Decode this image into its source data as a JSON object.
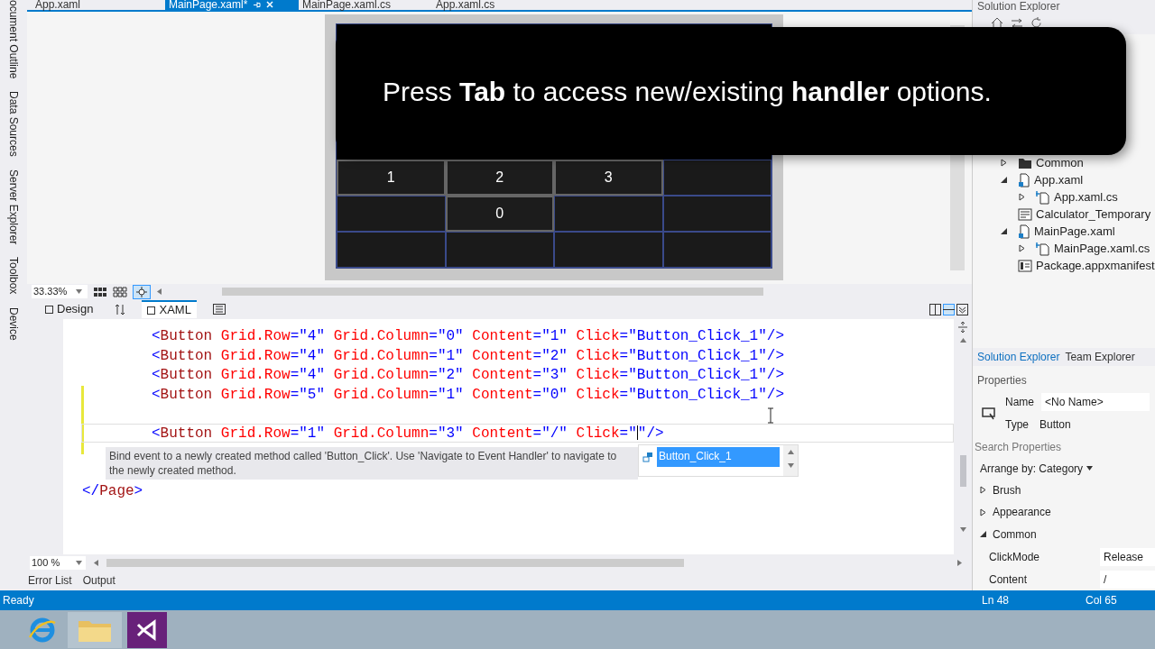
{
  "side_tabs": [
    "ocument Outline",
    "Data Sources",
    "Server Explorer",
    "Toolbox",
    "Device"
  ],
  "doc_tabs": [
    {
      "label": "App.xaml",
      "selected": false
    },
    {
      "label": "MainPage.xaml*",
      "selected": true
    },
    {
      "label": "MainPage.xaml.cs",
      "selected": false
    },
    {
      "label": "App.xaml.cs",
      "selected": false
    }
  ],
  "preview": {
    "rows": [
      [
        {
          "kind": "button",
          "label": "1"
        },
        {
          "kind": "button",
          "label": "2"
        },
        {
          "kind": "button",
          "label": "3"
        },
        {
          "kind": "empty"
        }
      ],
      [
        {
          "kind": "empty"
        },
        {
          "kind": "button",
          "label": "0"
        },
        {
          "kind": "empty"
        },
        {
          "kind": "empty"
        }
      ],
      [
        {
          "kind": "empty"
        },
        {
          "kind": "empty"
        },
        {
          "kind": "empty"
        },
        {
          "kind": "empty"
        }
      ]
    ]
  },
  "designer_zoom": "33.33%",
  "view_tabs": [
    {
      "label": "Design",
      "selected": false
    },
    {
      "label": "XAML",
      "selected": true
    }
  ],
  "code_lines": [
    {
      "kind": "nested",
      "current": false,
      "tokens": [
        {
          "kind": "bracket",
          "text": "<"
        },
        {
          "kind": "element",
          "text": "Button"
        },
        {
          "kind": "attr",
          "text": " Grid.Row"
        },
        {
          "kind": "bracket",
          "text": "="
        },
        {
          "kind": "value",
          "text": "\"4\""
        },
        {
          "kind": "attr",
          "text": " Grid.Column"
        },
        {
          "kind": "bracket",
          "text": "="
        },
        {
          "kind": "value",
          "text": "\"0\""
        },
        {
          "kind": "attr",
          "text": " Content"
        },
        {
          "kind": "bracket",
          "text": "="
        },
        {
          "kind": "value",
          "text": "\"1\""
        },
        {
          "kind": "attr",
          "text": " Click"
        },
        {
          "kind": "bracket",
          "text": "="
        },
        {
          "kind": "value",
          "text": "\"Button_Click_1\""
        },
        {
          "kind": "bracket",
          "text": "/>"
        }
      ]
    },
    {
      "kind": "nested",
      "current": false,
      "tokens": [
        {
          "kind": "bracket",
          "text": "<"
        },
        {
          "kind": "element",
          "text": "Button"
        },
        {
          "kind": "attr",
          "text": " Grid.Row"
        },
        {
          "kind": "bracket",
          "text": "="
        },
        {
          "kind": "value",
          "text": "\"4\""
        },
        {
          "kind": "attr",
          "text": " Grid.Column"
        },
        {
          "kind": "bracket",
          "text": "="
        },
        {
          "kind": "value",
          "text": "\"1\""
        },
        {
          "kind": "attr",
          "text": " Content"
        },
        {
          "kind": "bracket",
          "text": "="
        },
        {
          "kind": "value",
          "text": "\"2\""
        },
        {
          "kind": "attr",
          "text": " Click"
        },
        {
          "kind": "bracket",
          "text": "="
        },
        {
          "kind": "value",
          "text": "\"Button_Click_1\""
        },
        {
          "kind": "bracket",
          "text": "/>"
        }
      ]
    },
    {
      "kind": "nested",
      "current": false,
      "tokens": [
        {
          "kind": "bracket",
          "text": "<"
        },
        {
          "kind": "element",
          "text": "Button"
        },
        {
          "kind": "attr",
          "text": " Grid.Row"
        },
        {
          "kind": "bracket",
          "text": "="
        },
        {
          "kind": "value",
          "text": "\"4\""
        },
        {
          "kind": "attr",
          "text": " Grid.Column"
        },
        {
          "kind": "bracket",
          "text": "="
        },
        {
          "kind": "value",
          "text": "\"2\""
        },
        {
          "kind": "attr",
          "text": " Content"
        },
        {
          "kind": "bracket",
          "text": "="
        },
        {
          "kind": "value",
          "text": "\"3\""
        },
        {
          "kind": "attr",
          "text": " Click"
        },
        {
          "kind": "bracket",
          "text": "="
        },
        {
          "kind": "value",
          "text": "\"Button_Click_1\""
        },
        {
          "kind": "bracket",
          "text": "/>"
        }
      ]
    },
    {
      "kind": "nested",
      "current": false,
      "tokens": [
        {
          "kind": "bracket",
          "text": "<"
        },
        {
          "kind": "element",
          "text": "Button"
        },
        {
          "kind": "attr",
          "text": " Grid.Row"
        },
        {
          "kind": "bracket",
          "text": "="
        },
        {
          "kind": "value",
          "text": "\"5\""
        },
        {
          "kind": "attr",
          "text": " Grid.Column"
        },
        {
          "kind": "bracket",
          "text": "="
        },
        {
          "kind": "value",
          "text": "\"1\""
        },
        {
          "kind": "attr",
          "text": " Content"
        },
        {
          "kind": "bracket",
          "text": "="
        },
        {
          "kind": "value",
          "text": "\"0\""
        },
        {
          "kind": "attr",
          "text": " Click"
        },
        {
          "kind": "bracket",
          "text": "="
        },
        {
          "kind": "value",
          "text": "\"Button_Click_1\""
        },
        {
          "kind": "bracket",
          "text": "/>"
        }
      ]
    },
    {
      "kind": "blank"
    },
    {
      "kind": "nested",
      "current": true,
      "tokens": [
        {
          "kind": "bracket",
          "text": "<"
        },
        {
          "kind": "element",
          "text": "Button"
        },
        {
          "kind": "attr",
          "text": " Grid.Row"
        },
        {
          "kind": "bracket",
          "text": "="
        },
        {
          "kind": "value",
          "text": "\"1\""
        },
        {
          "kind": "attr",
          "text": " Grid.Column"
        },
        {
          "kind": "bracket",
          "text": "="
        },
        {
          "kind": "value",
          "text": "\"3\""
        },
        {
          "kind": "attr",
          "text": " Content"
        },
        {
          "kind": "bracket",
          "text": "="
        },
        {
          "kind": "value",
          "text": "\"/\""
        },
        {
          "kind": "attr",
          "text": " Click"
        },
        {
          "kind": "bracket",
          "text": "="
        },
        {
          "kind": "value",
          "text": "\""
        },
        {
          "kind": "caret"
        },
        {
          "kind": "value",
          "text": "\""
        },
        {
          "kind": "bracket",
          "text": "/>"
        }
      ]
    },
    {
      "kind": "blank"
    },
    {
      "kind": "blank"
    },
    {
      "kind": "top",
      "current": false,
      "tokens": [
        {
          "kind": "bracket",
          "text": "</"
        },
        {
          "kind": "element",
          "text": "Page"
        },
        {
          "kind": "bracket",
          "text": ">"
        }
      ]
    }
  ],
  "tooltip": "Bind event to a newly created method called 'Button_Click'. Use 'Navigate to Event Handler' to navigate to the newly created method.",
  "completion": [
    {
      "label": "Button_Click_1",
      "selected": true
    }
  ],
  "editor_zoom": "100 %",
  "bottom_tabs": [
    "Error List",
    "Output"
  ],
  "caption": "Press **Tab** to access new/existing **handler** options.",
  "solution_explorer": {
    "title": "Solution Explorer",
    "tree": [
      {
        "label": "Common",
        "kind": "folder",
        "expanded": false
      },
      {
        "label": "App.xaml",
        "kind": "xaml",
        "expanded": true,
        "children": [
          {
            "label": "App.xaml.cs",
            "kind": "cs",
            "expanded": false
          }
        ]
      },
      {
        "label": "Calculator_Temporary",
        "kind": "image"
      },
      {
        "label": "MainPage.xaml",
        "kind": "xaml",
        "expanded": true,
        "children": [
          {
            "label": "MainPage.xaml.cs",
            "kind": "cs",
            "expanded": false
          }
        ]
      },
      {
        "label": "Package.appxmanifest",
        "kind": "manifest"
      }
    ]
  },
  "panel_tabs": [
    {
      "label": "Solution Explorer",
      "selected": true
    },
    {
      "label": "Team Explorer",
      "selected": false
    }
  ],
  "properties": {
    "title": "Properties",
    "name_label": "Name",
    "name_value": "<No Name>",
    "type_label": "Type",
    "type_value": "Button",
    "search_placeholder": "Search Properties",
    "arrange": "Arrange by: Category",
    "categories": [
      {
        "label": "Brush",
        "expanded": false
      },
      {
        "label": "Appearance",
        "expanded": false
      },
      {
        "label": "Common",
        "expanded": true,
        "rows": [
          {
            "name": "ClickMode",
            "value": "Release"
          },
          {
            "name": "Content",
            "value": "/"
          }
        ]
      }
    ]
  },
  "status": {
    "text": "Ready",
    "line": "Ln 48",
    "col": "Col 65"
  }
}
